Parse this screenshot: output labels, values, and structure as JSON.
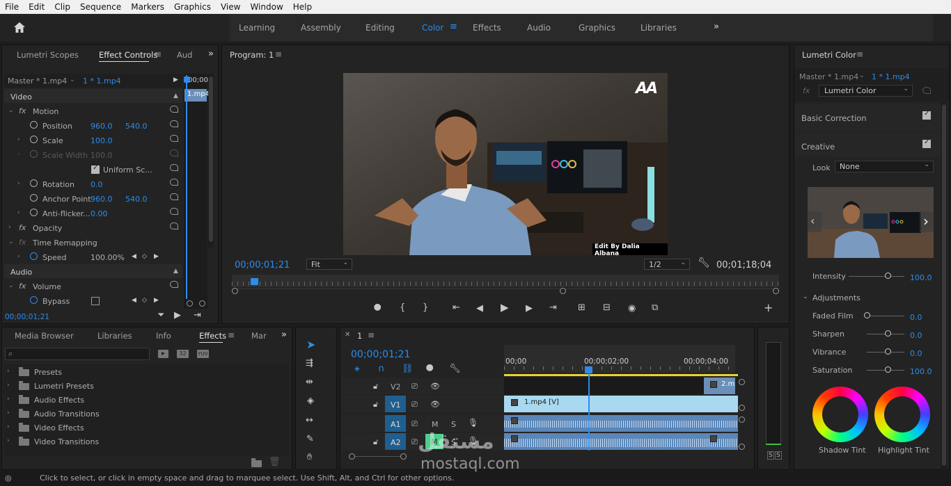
{
  "menu": [
    "File",
    "Edit",
    "Clip",
    "Sequence",
    "Markers",
    "Graphics",
    "View",
    "Window",
    "Help"
  ],
  "workspaces": {
    "learning": "Learning",
    "assembly": "Assembly",
    "editing": "Editing",
    "color": "Color",
    "effects": "Effects",
    "audio": "Audio",
    "graphics": "Graphics",
    "libraries": "Libraries"
  },
  "left_tabs": {
    "scopes": "Lumetri Scopes",
    "effect_controls": "Effect Controls",
    "audio": "Aud"
  },
  "effect_controls": {
    "master": "Master * 1.mp4",
    "clip": "1 * 1.mp4",
    "mini_time": "00;00",
    "mini_clip": "1.mp4",
    "video": "Video",
    "motion": "Motion",
    "position": "Position",
    "pos_x": "960.0",
    "pos_y": "540.0",
    "scale": "Scale",
    "scale_val": "100.0",
    "scale_width": "Scale Width",
    "scale_width_val": "100.0",
    "uniform": "Uniform Sc...",
    "rotation": "Rotation",
    "rotation_val": "0.0",
    "anchor": "Anchor Point",
    "anchor_x": "960.0",
    "anchor_y": "540.0",
    "antiflicker": "Anti-flicker...",
    "antiflicker_val": "0.00",
    "opacity": "Opacity",
    "time_remap": "Time Remapping",
    "speed": "Speed",
    "speed_val": "100.00%",
    "audio": "Audio",
    "volume": "Volume",
    "bypass": "Bypass",
    "timecode": "00;00;01;21"
  },
  "program": {
    "title": "Program: 1",
    "timecode": "00;00;01;21",
    "fit": "Fit",
    "res": "1/2",
    "duration": "00;01;18;04",
    "logo": "AA",
    "caption": "Edit By Dalia Albana"
  },
  "bottom_tabs": {
    "media": "Media Browser",
    "libraries": "Libraries",
    "info": "Info",
    "effects": "Effects",
    "markers": "Mar"
  },
  "effects_list": [
    "Presets",
    "Lumetri Presets",
    "Audio Effects",
    "Audio Transitions",
    "Video Effects",
    "Video Transitions"
  ],
  "effects_badges": [
    "32",
    "YUV"
  ],
  "timeline": {
    "tab": "1",
    "timecode": "00;00;01;21",
    "ruler": [
      "00;00",
      "00;00;02;00",
      "00;00;04;00"
    ],
    "tracks": [
      "V2",
      "V1",
      "A1",
      "A2"
    ],
    "clip_v1": "1.mp4 [V]",
    "clip_v2": "2.m",
    "m": "M",
    "s": "S"
  },
  "meter": {
    "s1": "S",
    "s2": "S"
  },
  "lumetri": {
    "title": "Lumetri Color",
    "master": "Master * 1.mp4",
    "clip": "1 * 1.mp4",
    "effect": "Lumetri Color",
    "basic": "Basic Correction",
    "creative": "Creative",
    "look": "Look",
    "look_val": "None",
    "intensity": "Intensity",
    "intensity_val": "100.0",
    "adjustments": "Adjustments",
    "faded": "Faded Film",
    "faded_val": "0.0",
    "sharpen": "Sharpen",
    "sharpen_val": "0.0",
    "vibrance": "Vibrance",
    "vibrance_val": "0.0",
    "saturation": "Saturation",
    "saturation_val": "100.0",
    "shadow": "Shadow Tint",
    "highlight": "Highlight Tint"
  },
  "status": "Click to select, or click in empty space and drag to marquee select. Use Shift, Alt, and Ctrl for other options.",
  "watermark": {
    "arabic": "مستقل",
    "latin": "mostaql.com"
  },
  "colors": {
    "accent": "#2d8ceb",
    "video_clip": "#a9d9f0",
    "audio_clip": "#5a86b8",
    "target": "#1f5f8f"
  }
}
